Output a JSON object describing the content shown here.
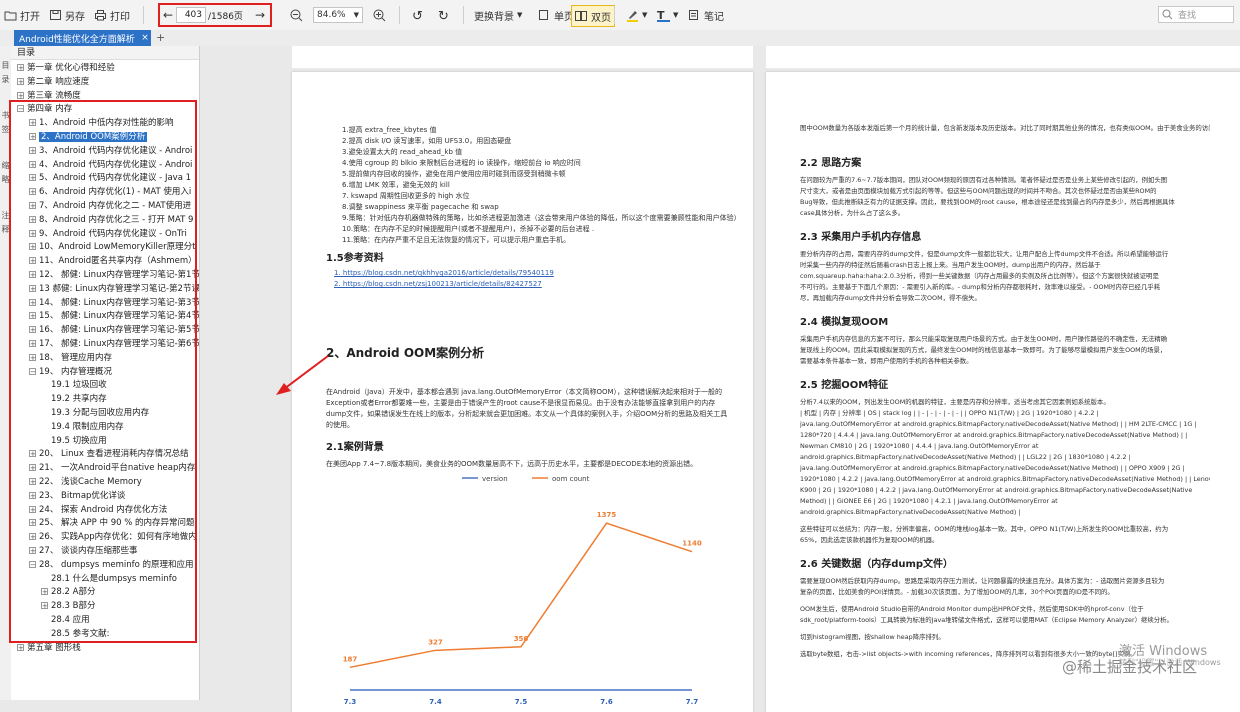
{
  "toolbar": {
    "open": "打开",
    "save_as": "另存",
    "print": "打印",
    "current_page": "403",
    "total_pages": "/1586页",
    "zoom": "84.6%",
    "bg": "更换背景",
    "single": "单页",
    "double": "双页",
    "notes": "笔记",
    "search_placeholder": "查找"
  },
  "tab": {
    "title": "Android性能优化全方面解析",
    "close": "×",
    "new": "+"
  },
  "left_icons": [
    "目",
    "录",
    "书",
    "签",
    "缩",
    "略",
    "注",
    "释"
  ],
  "toc": {
    "header": "目录",
    "items": [
      {
        "text": "第一章 优化心得和经验",
        "level": 0,
        "exp": "+"
      },
      {
        "text": "第二章 响应速度",
        "level": 0,
        "exp": "+"
      },
      {
        "text": "第三章 流畅度",
        "level": 0,
        "exp": "+"
      },
      {
        "text": "第四章 内存",
        "level": 0,
        "exp": "−"
      },
      {
        "text": "1、Android 中低内存对性能的影响",
        "level": 1,
        "exp": "+"
      },
      {
        "text": "2、Android OOM案例分析",
        "level": 1,
        "exp": "+",
        "selected": true
      },
      {
        "text": "3、Android 代码内存优化建议 - Androi",
        "level": 1,
        "exp": "+"
      },
      {
        "text": "4、Android 代码内存优化建议 - Androi",
        "level": 1,
        "exp": "+"
      },
      {
        "text": "5、Android 代码内存优化建议 - Java 1",
        "level": 1,
        "exp": "+"
      },
      {
        "text": "6、Android 内存优化(1) - MAT 使用入i",
        "level": 1,
        "exp": "+"
      },
      {
        "text": "7、Android 内存优化之二 - MAT使用进",
        "level": 1,
        "exp": "+"
      },
      {
        "text": "8、Android 内存优化之三 - 打开 MAT 9",
        "level": 1,
        "exp": "+"
      },
      {
        "text": "9、Android 代码内存优化建议 - OnTri",
        "level": 1,
        "exp": "+"
      },
      {
        "text": "10、Android LowMemoryKiller原理分t",
        "level": 1,
        "exp": "+"
      },
      {
        "text": "11、Android匿名共享内存（Ashmem）",
        "level": 1,
        "exp": "+"
      },
      {
        "text": "12、 郝健: Linux内存管理学习笔记-第1节",
        "level": 1,
        "exp": "+"
      },
      {
        "text": "13 郝健: Linux内存管理学习笔记-第2节课",
        "level": 1,
        "exp": "+"
      },
      {
        "text": "14、 郝健: Linux内存管理学习笔记-第3节",
        "level": 1,
        "exp": "+"
      },
      {
        "text": "15、 郝健: Linux内存管理学习笔记-第4节",
        "level": 1,
        "exp": "+"
      },
      {
        "text": "16、 郝健: Linux内存管理学习笔记-第5节",
        "level": 1,
        "exp": "+"
      },
      {
        "text": "17、 郝健: Linux内存管理学习笔记-第6节",
        "level": 1,
        "exp": "+"
      },
      {
        "text": "18、 管理应用内存",
        "level": 1,
        "exp": "+"
      },
      {
        "text": "19、 内存管理概况",
        "level": 1,
        "exp": "−"
      },
      {
        "text": "19.1 垃圾回收",
        "level": 2,
        "exp": ""
      },
      {
        "text": "19.2 共享内存",
        "level": 2,
        "exp": ""
      },
      {
        "text": "19.3 分配与回收应用内存",
        "level": 2,
        "exp": ""
      },
      {
        "text": "19.4 限制应用内存",
        "level": 2,
        "exp": ""
      },
      {
        "text": "19.5 切换应用",
        "level": 2,
        "exp": ""
      },
      {
        "text": "20、 Linux 查看进程消耗内存情况总结",
        "level": 1,
        "exp": "+"
      },
      {
        "text": "21、 一次Android平台native heap内存",
        "level": 1,
        "exp": "+"
      },
      {
        "text": "22、 浅谈Cache Memory",
        "level": 1,
        "exp": "+"
      },
      {
        "text": "23、 Bitmap优化详谈",
        "level": 1,
        "exp": "+"
      },
      {
        "text": "24、 探索 Android 内存优化方法",
        "level": 1,
        "exp": "+"
      },
      {
        "text": "25、 解决 APP 中 90 % 的内存异常问题",
        "level": 1,
        "exp": "+"
      },
      {
        "text": "26、 实践App内存优化：如何有序地做内",
        "level": 1,
        "exp": "+"
      },
      {
        "text": "27、 谈谈内存压缩那些事",
        "level": 1,
        "exp": "+"
      },
      {
        "text": "28、 dumpsys meminfo 的原理和应用",
        "level": 1,
        "exp": "−"
      },
      {
        "text": "28.1 什么是dumpsys meminfo",
        "level": 2,
        "exp": ""
      },
      {
        "text": "28.2 A部分",
        "level": 2,
        "exp": "+"
      },
      {
        "text": "28.3 B部分",
        "level": 2,
        "exp": "+"
      },
      {
        "text": "28.4 应用",
        "level": 2,
        "exp": ""
      },
      {
        "text": "28.5 参考文献:",
        "level": 2,
        "exp": ""
      },
      {
        "text": "第五章 图形栈",
        "level": 0,
        "exp": "+"
      }
    ]
  },
  "left_page": {
    "list_lines": [
      "1.提高 extra_free_kbytes 值",
      "2.提高 disk I/O 读写速率，如用 UFS3.0，用固态硬盘",
      "3.避免设置太大的 read_ahead_kb 值",
      "4.使用 cgroup 的 blkio 来限制后台进程的 io 读操作，缩短前台 io 响应时间",
      "5.提前做内存回收的操作，避免在用户使用应用时碰到而感受到稍微卡顿",
      "6.增加 LMK 效率，避免无效的 kill",
      "7. kswapd 周期性回收更多的 high 水位",
      "8.调整 swappiness 来平衡 pagecache 和 swap",
      "9.策略：针对低内存机器做特殊的策略，比如杀进程更加激进（这会带来用户体验的降低，所以这个度需要兼顾性能和用户体验）",
      "10.策略：在内存不足的时候提醒用户(或者不提醒用户)，杀掉不必要的后台进程 .",
      "11.策略：在内存严重不足且无法恢复的情况下，可以提示用户重启手机。"
    ],
    "ref_title": "1.5参考资料",
    "refs": [
      "1. https://blog.csdn.net/qkhhyga2016/article/details/79540119",
      "2. https://blog.csdn.net/zsj100213/article/details/82427527"
    ],
    "section_title": "2、Android OOM案例分析",
    "intro_lines": [
      "在Android（Java）开发中，基本都会遇到 java.lang.OutOfMemoryError（本文简称OOM），这种错误解决起来相对于一般的",
      "Exception或者Error都要难一些，主要是由于错误产生的root cause不是很显而易见。由于没有办法能够直接拿到用户的内存",
      "dump文件，如果错误发生在线上的版本，分析起来就会更加困难。本文从一个具体的案例入手，介绍OOM分析的思路及相关工具",
      "的使用。"
    ],
    "bg_title": "2.1案例背景",
    "bg_line": "在美团App 7.4~7.8版本期间，美食业务的OOM数量居高不下，远高于历史水平，主要都是DECODE本地的资源出错。"
  },
  "chart_data": {
    "type": "line",
    "categories": [
      "7.3",
      "7.4",
      "7.5",
      "7.6",
      "7.7"
    ],
    "series": [
      {
        "name": "version",
        "values": [
          0,
          0,
          0,
          0,
          0
        ],
        "color": "#4a72c4"
      },
      {
        "name": "oom count",
        "values": [
          187,
          327,
          356,
          1375,
          1140
        ],
        "color": "#ee7d31"
      }
    ],
    "ylim": [
      0,
      1500
    ],
    "grid": false,
    "legend": "top"
  },
  "right_page": {
    "top_line": "图中OOM数量为各版本发版后第一个月的统计量，包含新发版本及历史版本。对比了同时期其他业务的情况，也有类似OOM。由于美食业务的访问量占美团App的比重较大，因此，OOM的数量相对其他业务也多一些。",
    "sections": [
      {
        "title": "2.2 思路方案",
        "lines": [
          "在问题较为严重的7.6~7.7版本期间，团队对OOM频现的原因有过各种猜测。笔者怀疑过是否是业务上某些修改引起的，例如头图",
          "尺寸变大，或者是由页面模块加载方式引起的等等。但这些与OOM问题出现的时间并不吻合。其次也怀疑过是否由某些ROM的",
          "Bug导致，但此推断缺乏有力的证据支撑。因此，要找到OOM的root cause，根本途径还是找到最占的内存是多少，然后再根据具体",
          "case具体分析，为什么占了这么多。"
        ]
      },
      {
        "title": "2.3 采集用户手机内存信息",
        "lines": [
          "要分析内存的占用，需要内存的dump文件，但是dump文件一般都比较大，让用户配合上传dump文件不合适。所以希望能够运行",
          "时采集一些内存的特征然后随着crash日志上报上来。当用户发生OOM时，dump出用户的内存，然后基于",
          "com.squareup.haha:haha:2.0.3分析，得到一些关键数据（内存占用最多的实例及所占比例等）。但这个方案很快就被证明是",
          "不可行的。主要基于下面几个原因：- 需要引入新的库。- dump和分析内存都很耗时，效率难以接受。- OOM时内存已经几乎耗",
          "尽，再加载内存dump文件并分析会导致二次OOM，得不偿失。"
        ]
      },
      {
        "title": "2.4 模拟复现OOM",
        "lines": [
          "采集用户手机内存信息的方案不可行，那么只能采取复现用户场景的方式。由于发生OOM时，用户操作路径的不确定性，无法精确",
          "复现线上的OOM。因此采取模拟复现的方式，最终发生OOM时的栈信息基本一致即可。为了能够尽量模拟用户发生OOM的场景，",
          "需要基本条件基本一致，即用户使用的手机的各种相关参数。"
        ]
      },
      {
        "title": "2.5 挖掘OOM特征",
        "lines": [
          "分析7.4以来的OOM，列出发生OOM的机器的特征，主要是内存和分辨率，适当考虑其它因素例如系统版本。",
          "| 机型 | 内存 | 分辨率 | OS | stack log | | - | - | - | - | - | | OPPO N1(T/W) | 2G | 1920*1080 | 4.2.2 |",
          "java.lang.OutOfMemoryError at android.graphics.BitmapFactory.nativeDecodeAsset(Native Method) | | HM 2LTE-CMCC | 1G |",
          "1280*720 | 4.4.4 | java.lang.OutOfMemoryError at android.graphics.BitmapFactory.nativeDecodeAsset(Native Method) | |",
          "Newman CM810 | 2G | 1920*1080 | 4.4.4 | java.lang.OutOfMemoryError at",
          "android.graphics.BitmapFactory.nativeDecodeAsset(Native Method) | | LGL22 | 2G | 1830*1080 | 4.2.2 |",
          "java.lang.OutOfMemoryError at android.graphics.BitmapFactory.nativeDecodeAsset(Native Method) | | OPPO X909 | 2G |",
          "1920*1080 | 4.2.2 | java.lang.OutOfMemoryError at android.graphics.BitmapFactory.nativeDecodeAsset(Native Method) | | Lenovo",
          "K900 | 2G | 1920*1080 | 4.2.2 | java.lang.OutOfMemoryError at android.graphics.BitmapFactory.nativeDecodeAsset(Native",
          "Method) | | GiONEE E6 | 2G | 1920*1080 | 4.2.1 | java.lang.OutOfMemoryError at",
          "android.graphics.BitmapFactory.nativeDecodeAsset(Native Method) |",
          "",
          "这些特征可以总结为：内存一般，分辨率偏高，OOM的堆栈log基本一致。其中，OPPO N1(T/W)上所发生的OOM比重较高，约为",
          "65%，因此选定该款机器作为复现OOM的机器。"
        ]
      },
      {
        "title": "2.6 关键数据（内存dump文件）",
        "lines": [
          "需要复现OOM然后获取内存dump。思路是采取内存压力测试，让问题暴露的快速且充分。具体方案为：- 选取图片资源多且较为",
          "复杂的页面，比如美食的POI详情页。- 加载30次该页面，为了增加OOM的几率，30个POI页面的ID是不同的。",
          "",
          "OOM发生后，使用Android Studio自带的Android Monitor dump出HPROF文件，然后使用SDK中的hprof-conv（位于",
          "sdk_root/platform-tools）工具转换为标准的Java堆转储文件格式，这样可以使用MAT（Eclipse Memory Analyzer）继续分析。",
          "",
          "切到histogram视图，按shallow heap降序排列。",
          "",
          "选取byte数组，右击->list objects->with incoming references，降序排列可以看到有很多大小一致的byte[]实例。"
        ]
      }
    ]
  },
  "watermarks": {
    "windows_line1": "激活 Windows",
    "windows_line2": "转到\"设置\"以激活 Windows",
    "juejin": "@稀土掘金技术社区"
  }
}
